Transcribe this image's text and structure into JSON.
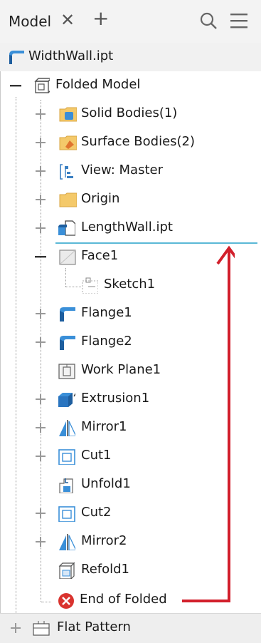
{
  "header": {
    "tab_label": "Model",
    "close_glyph": "✕",
    "add_glyph": "+"
  },
  "tree": {
    "root": "WidthWall.ipt",
    "folded_model": "Folded Model",
    "items": {
      "solid_bodies": "Solid Bodies(1)",
      "surface_bodies": "Surface Bodies(2)",
      "view_master": "View: Master",
      "origin": "Origin",
      "length_wall": "LengthWall.ipt",
      "face1": "Face1",
      "sketch1": "Sketch1",
      "flange1": "Flange1",
      "flange2": "Flange2",
      "work_plane1": "Work Plane1",
      "extrusion1": "Extrusion1",
      "mirror1": "Mirror1",
      "cut1": "Cut1",
      "unfold1": "Unfold1",
      "cut2": "Cut2",
      "mirror2": "Mirror2",
      "refold1": "Refold1",
      "end_of_folded": "End of Folded"
    },
    "flat_pattern": "Flat Pattern"
  },
  "colors": {
    "annotation_arrow": "#d21f2b",
    "drop_line": "#5bb8d6",
    "end_marker": "#d9332e"
  },
  "icons": {
    "search": "search-icon",
    "menu": "hamburger-menu-icon"
  }
}
